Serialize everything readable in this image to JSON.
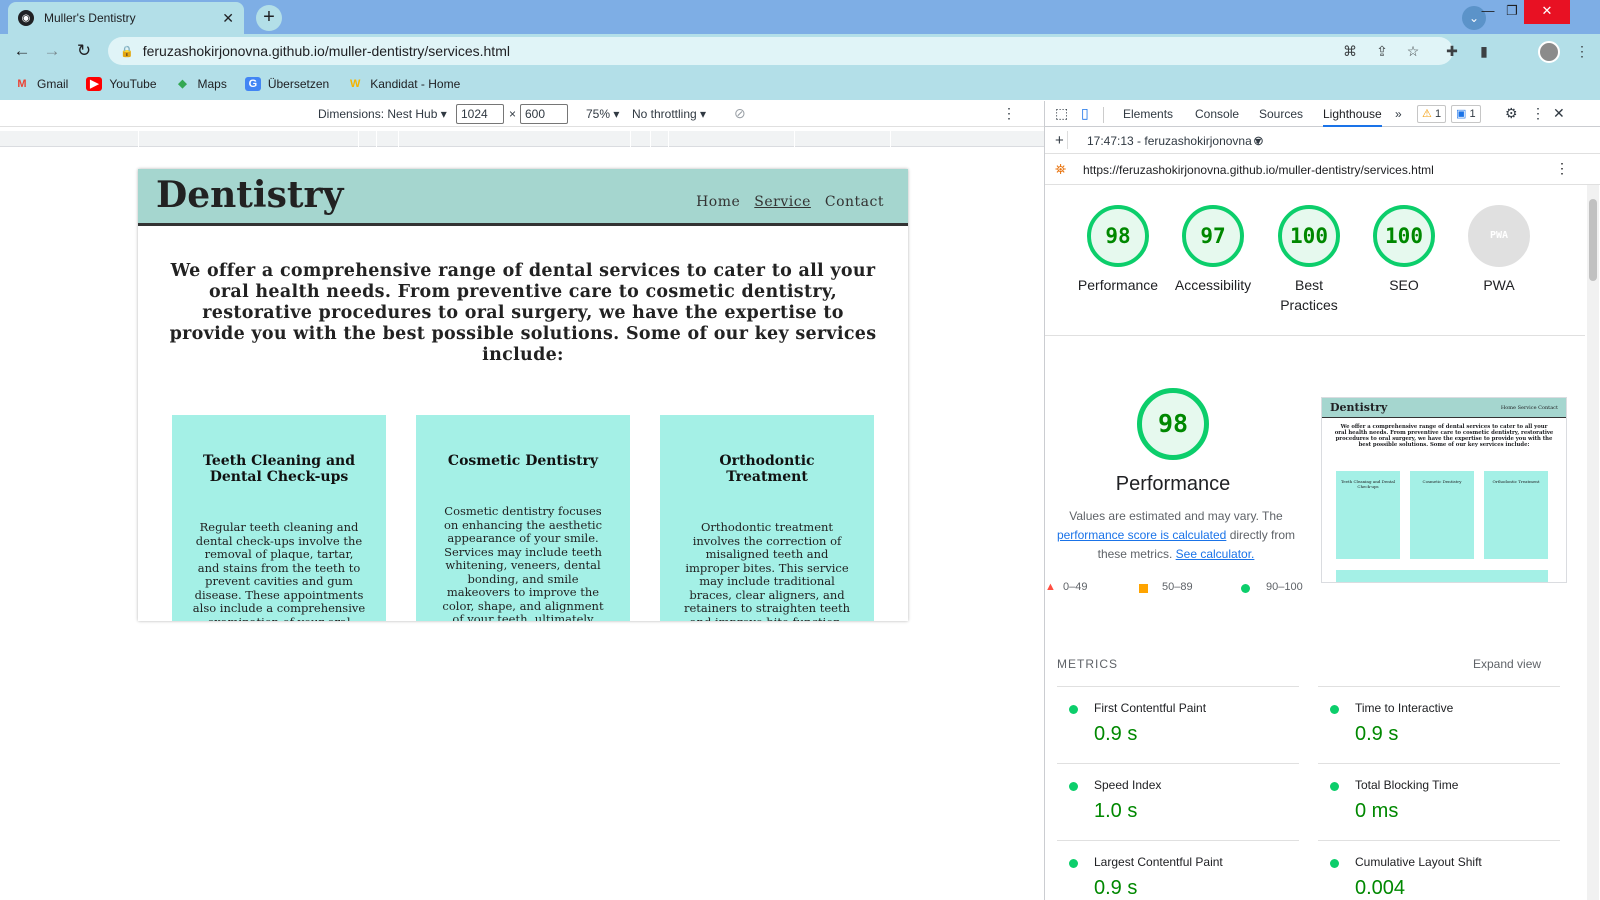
{
  "browser": {
    "tab_title": "Muller's Dentistry",
    "url": "feruzashokirjonovna.github.io/muller-dentistry/services.html",
    "bookmarks": [
      {
        "label": "Gmail",
        "icon": "gmail-icon",
        "color": "#ea4335"
      },
      {
        "label": "YouTube",
        "icon": "youtube-icon",
        "color": "#ff0000"
      },
      {
        "label": "Maps",
        "icon": "maps-icon",
        "color": "#34a853"
      },
      {
        "label": "Übersetzen",
        "icon": "translate-icon",
        "color": "#4285f4"
      },
      {
        "label": "Kandidat - Home",
        "icon": "kandidat-icon",
        "color": "#f5b400"
      }
    ]
  },
  "device_toolbar": {
    "dimensions_label": "Dimensions: Nest Hub",
    "width": "1024",
    "height": "600",
    "zoom": "75%",
    "throttling": "No throttling"
  },
  "site": {
    "logo": "Dentistry",
    "nav": [
      "Home",
      "Service",
      "Contact"
    ],
    "active_nav": "Service",
    "intro": "We offer a comprehensive range of dental services to cater to all your oral health needs. From preventive care to cosmetic dentistry, restorative procedures to oral surgery, we have the expertise to provide you with the best possible solutions. Some of our key services include:",
    "services": [
      {
        "title": "Teeth Cleaning and Dental Check-ups",
        "text": "Regular teeth cleaning and dental check-ups involve the removal of plaque, tartar, and stains from the teeth to prevent cavities and gum disease. These appointments also include a comprehensive examination of your oral health, including"
      },
      {
        "title": "Cosmetic Dentistry",
        "text": "Cosmetic dentistry focuses on enhancing the aesthetic appearance of your smile. Services may include teeth whitening, veneers, dental bonding, and smile makeovers to improve the color, shape, and alignment of your teeth, ultimately boosting your self-"
      },
      {
        "title": "Orthodontic Treatment",
        "text": "Orthodontic treatment involves the correction of misaligned teeth and improper bites. This service may include traditional braces, clear aligners, and retainers to straighten teeth and improve bite function, ensuring a healthier and"
      }
    ]
  },
  "devtools": {
    "tabs": [
      "Elements",
      "Console",
      "Sources",
      "Lighthouse"
    ],
    "active_tab": "Lighthouse",
    "warnings": "1",
    "messages": "1",
    "report_label": "17:47:13 - feruzashokirjonovna",
    "report_url": "https://feruzashokirjonovna.github.io/muller-dentistry/services.html",
    "scores": [
      {
        "label": "Performance",
        "value": "98"
      },
      {
        "label": "Accessibility",
        "value": "97"
      },
      {
        "label": "Best Practices",
        "value": "100"
      },
      {
        "label": "SEO",
        "value": "100"
      },
      {
        "label": "PWA",
        "value": "PWA"
      }
    ],
    "performance": {
      "score": "98",
      "title": "Performance",
      "desc_1": "Values are estimated and may vary. The",
      "desc_link": "performance score is calculated",
      "desc_2": "directly from these metrics.",
      "calc_link": "See calculator.",
      "legend": [
        "0–49",
        "50–89",
        "90–100"
      ],
      "legend_colors": [
        "#ff4e42",
        "#ffa400",
        "#0cce6b"
      ]
    },
    "thumbnail": {
      "logo": "Dentistry",
      "nav": "Home  Service  Contact",
      "cards": [
        "Teeth Cleaning and Dental Check-ups",
        "Cosmetic Dentistry",
        "Orthodontic Treatment"
      ]
    },
    "metrics_title": "METRICS",
    "expand_view": "Expand view",
    "metrics": [
      {
        "name": "First Contentful Paint",
        "value": "0.9 s"
      },
      {
        "name": "Time to Interactive",
        "value": "0.9 s"
      },
      {
        "name": "Speed Index",
        "value": "1.0 s"
      },
      {
        "name": "Total Blocking Time",
        "value": "0 ms"
      },
      {
        "name": "Largest Contentful Paint",
        "value": "0.9 s"
      },
      {
        "name": "Cumulative Layout Shift",
        "value": "0.004"
      }
    ]
  }
}
